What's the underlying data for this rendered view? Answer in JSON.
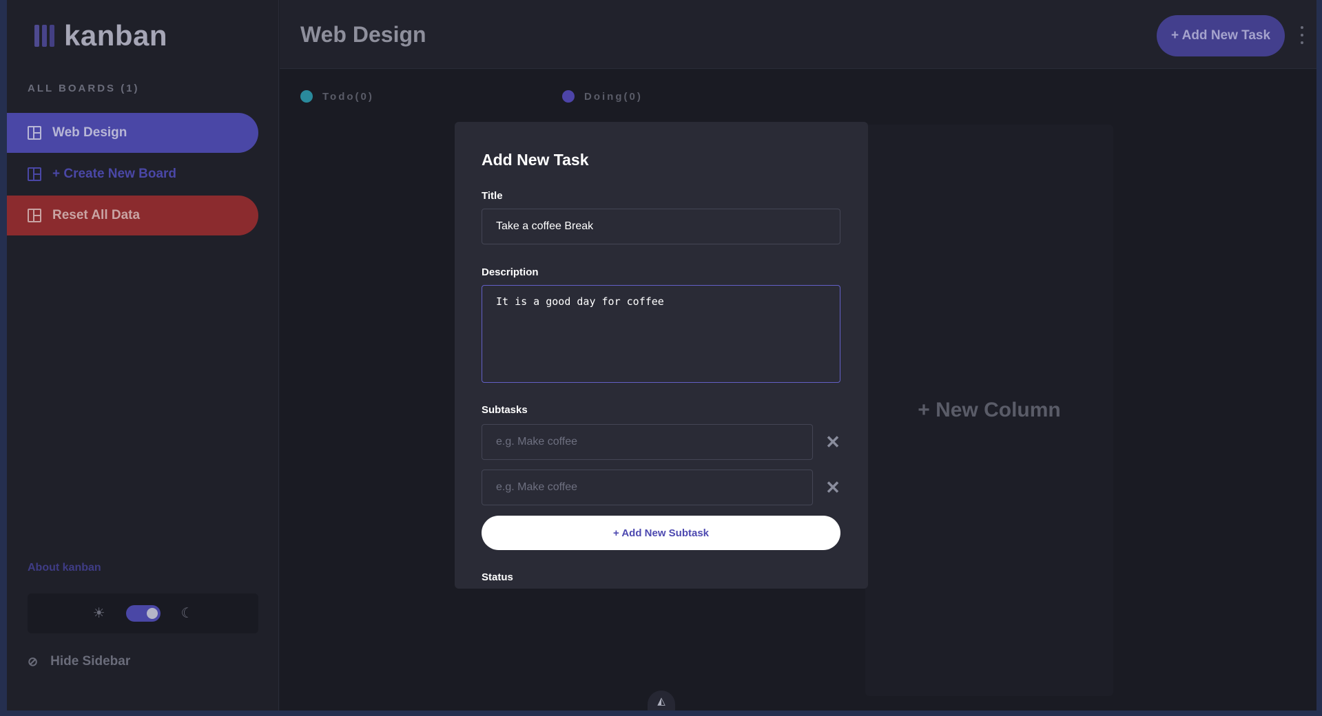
{
  "app": {
    "logo_text": "kanban"
  },
  "sidebar": {
    "heading": "ALL BOARDS (1)",
    "items": [
      {
        "label": "Web Design"
      },
      {
        "label": "+ Create New Board"
      },
      {
        "label": "Reset All Data"
      }
    ],
    "about": "About kanban",
    "hide_label": "Hide Sidebar"
  },
  "header": {
    "title": "Web Design",
    "add_task_label": "+ Add New Task"
  },
  "board": {
    "columns": [
      {
        "label": "Todo(0)",
        "color": "#2a8a9c"
      },
      {
        "label": "Doing(0)",
        "color": "#4d44a8"
      }
    ],
    "new_column_label": "+ New Column"
  },
  "modal": {
    "title": "Add New Task",
    "title_label": "Title",
    "title_value": "Take a coffee Break",
    "description_label": "Description",
    "description_value": "It is a good day for coffee",
    "subtasks_label": "Subtasks",
    "subtask_placeholder": "e.g. Make coffee",
    "add_subtask_label": "+ Add New Subtask",
    "status_label": "Status"
  },
  "colors": {
    "accent": "#4a47a6",
    "danger": "#8b2b2e"
  }
}
